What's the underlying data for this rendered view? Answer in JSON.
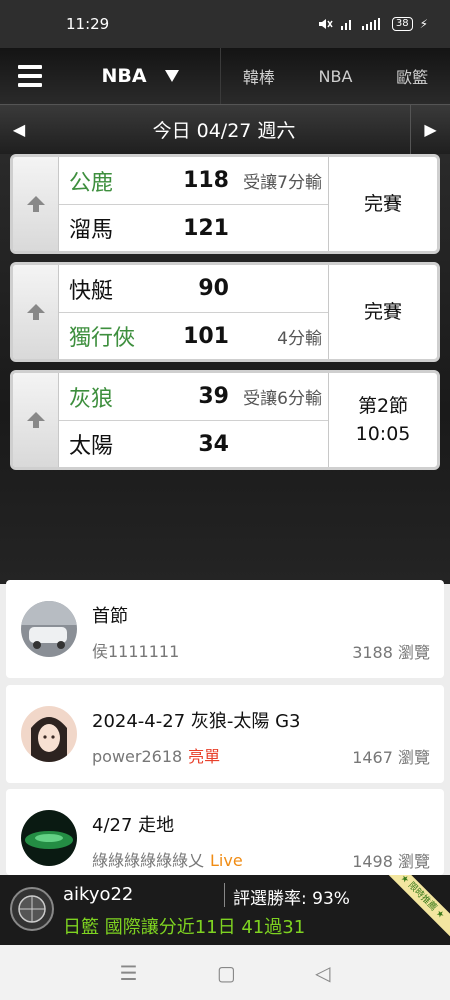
{
  "status_bar": {
    "time": "11:29",
    "icons": [
      "wifi-icon",
      "signal-icon",
      "lte-icon"
    ],
    "battery": "38"
  },
  "header": {
    "league": "NBA",
    "tabs": [
      "韓棒",
      "NBA",
      "歐籃"
    ]
  },
  "date_bar": {
    "date": "今日 04/27 週六"
  },
  "games": [
    {
      "home": {
        "name": "公鹿",
        "score": "118",
        "odds": "受讓7分輸",
        "highlight": true
      },
      "away": {
        "name": "溜馬",
        "score": "121",
        "odds": "",
        "highlight": false
      },
      "status_line1": "完賽",
      "status_line2": ""
    },
    {
      "home": {
        "name": "快艇",
        "score": "90",
        "odds": "",
        "highlight": false
      },
      "away": {
        "name": "獨行俠",
        "score": "101",
        "odds": "4分輸",
        "highlight": true
      },
      "status_line1": "完賽",
      "status_line2": ""
    },
    {
      "home": {
        "name": "灰狼",
        "score": "39",
        "odds": "受讓6分輸",
        "highlight": true
      },
      "away": {
        "name": "太陽",
        "score": "34",
        "odds": "",
        "highlight": false
      },
      "status_line1": "第2節",
      "status_line2": "10:05"
    }
  ],
  "posts": [
    {
      "title": "首節",
      "author": "侯1111111",
      "tag": "",
      "views": "3188 瀏覽"
    },
    {
      "title": "2024-4-27 灰狼-太陽 G3",
      "author": "power2618",
      "tag": "亮單",
      "tag_color": "#e8412c",
      "views": "1467 瀏覽"
    },
    {
      "title": "4/27 走地",
      "author": "綠綠綠綠綠綠乂",
      "tag": "Live",
      "tag_color": "#f08c14",
      "views": "1498 瀏覽"
    }
  ],
  "banner": {
    "user": "aikyo22",
    "win_rate": "評選勝率: 93%",
    "pick": "日籃 國際讓分近11日 41過31",
    "ribbon": "★ 限時推薦 ★"
  },
  "nav": {
    "icons": [
      "menu-icon",
      "home-icon",
      "back-icon"
    ]
  },
  "colors": {
    "highlight_team": "#3e8f3e",
    "banner_pick": "#7ed321"
  }
}
